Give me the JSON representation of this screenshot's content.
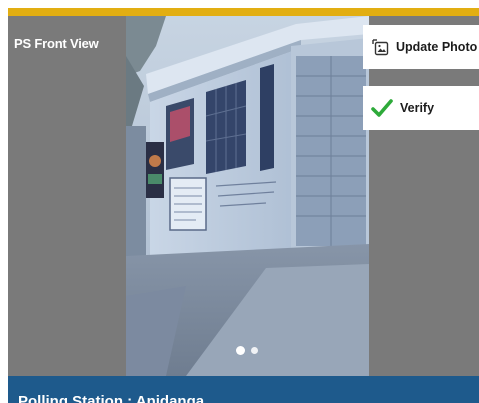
{
  "header": {
    "accent_color": "#e2ae12"
  },
  "viewer": {
    "title": "PS Front View",
    "background_color": "#7a7a7a",
    "photo_description_icon": "building-photo",
    "carousel": {
      "total": 2,
      "active_index": 0
    }
  },
  "actions": {
    "update_photo_label": "Update Photo",
    "update_photo_icon": "photo-replace-icon",
    "verify_label": "Verify",
    "verify_icon": "check-icon",
    "verify_color": "#2eaa3a"
  },
  "footer": {
    "title": "Polling Station : Anjdanga",
    "background_color": "#1e5a8c"
  }
}
